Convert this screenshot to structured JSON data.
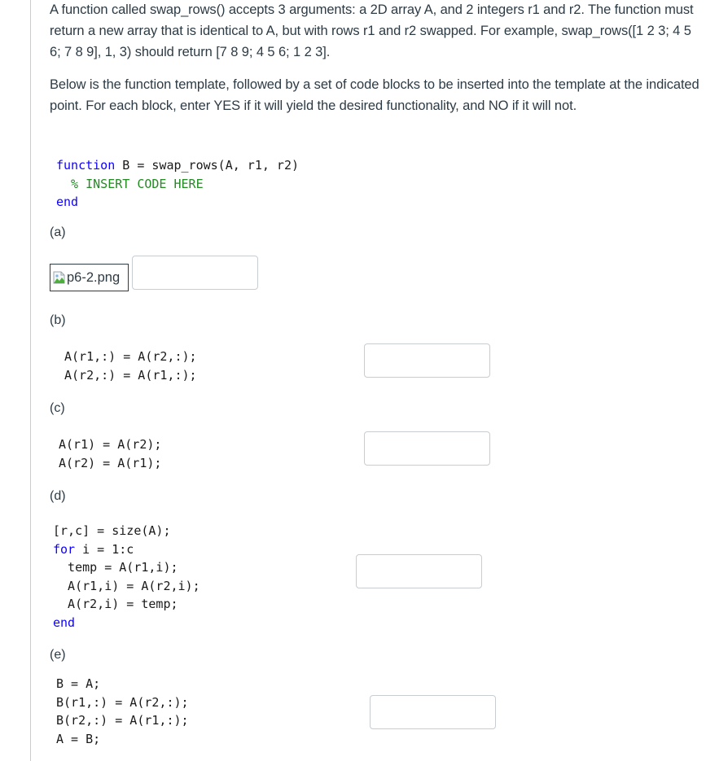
{
  "question": {
    "intro": "A function called swap_rows() accepts 3 arguments: a 2D array A, and 2 integers r1 and r2. The function must return a new array that is identical to A, but with rows r1 and r2 swapped. For example, swap_rows([1 2 3; 4 5 6; 7 8 9], 1, 3) should return [7 8 9; 4 5 6; 1 2 3].",
    "instructions": "Below is the function template, followed by a set of code blocks to be inserted into the template at the indicated point. For each block, enter YES if it will yield the desired functionality, and NO if it will not."
  },
  "template": {
    "line1_keyword": "function",
    "line1_rest": " B = swap_rows(A, r1, r2)",
    "line2_comment": "  % INSERT CODE HERE",
    "line3_keyword": "end"
  },
  "parts": [
    {
      "label": "(a)",
      "image_alt": "p6-2.png",
      "image_icon": "broken-image-icon",
      "answer_value": ""
    },
    {
      "label": "(b)",
      "code_lines": [
        "A(r1,:) = A(r2,:);",
        "A(r2,:) = A(r1,:);"
      ],
      "answer_value": ""
    },
    {
      "label": "(c)",
      "code_lines": [
        "A(r1) = A(r2);",
        "A(r2) = A(r1);"
      ],
      "answer_value": ""
    },
    {
      "label": "(d)",
      "code_lines": [
        "[r,c] = size(A);",
        "for",
        " i = 1:c",
        "  temp = A(r1,i);",
        "  A(r1,i) = A(r2,i);",
        "  A(r2,i) = temp;",
        "end"
      ],
      "answer_value": ""
    },
    {
      "label": "(e)",
      "code_lines": [
        "B = A;",
        "B(r1,:) = A(r2,:);",
        "B(r2,:) = A(r1,:);",
        "A = B;"
      ],
      "answer_value": ""
    }
  ],
  "colors": {
    "keyword": "#0e00ff",
    "comment": "#228b22",
    "text": "#2d3b45",
    "input_border": "#c7cdd1"
  }
}
